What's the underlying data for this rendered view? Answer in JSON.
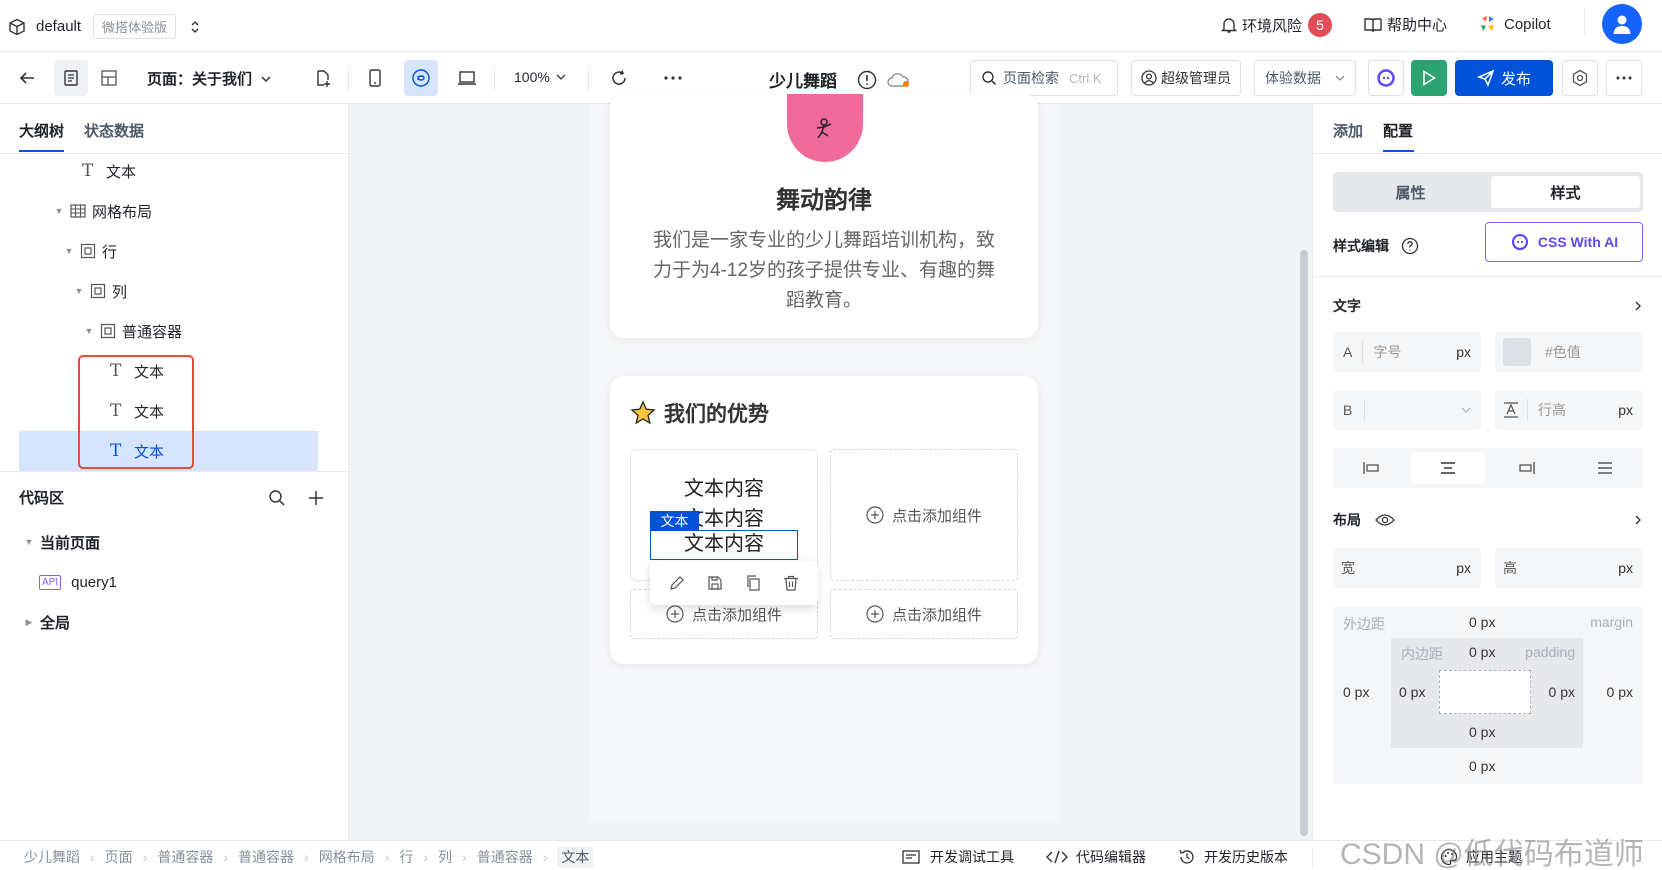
{
  "topbar": {
    "workspace": "default",
    "edition_badge": "微搭体验版",
    "env_risk_label": "环境风险",
    "env_risk_count": "5",
    "help_label": "帮助中心",
    "copilot_label": "Copilot"
  },
  "toolbar": {
    "page_label": "页面：关于我们",
    "zoom": "100%",
    "app_title": "少儿舞蹈",
    "search_placeholder": "页面检索",
    "search_shortcut": "Ctrl K",
    "admin_label": "超级管理员",
    "data_select": "体验数据",
    "publish_label": "发布"
  },
  "left_panel": {
    "tabs": [
      "大纲树",
      "状态数据"
    ],
    "tree": [
      {
        "label": "文本",
        "icon": "T",
        "caret": false
      },
      {
        "label": "网格布局",
        "icon": "grid",
        "caret": true
      },
      {
        "label": "行",
        "icon": "box",
        "caret": true
      },
      {
        "label": "列",
        "icon": "box",
        "caret": true
      },
      {
        "label": "普通容器",
        "icon": "box",
        "caret": true
      },
      {
        "label": "文本",
        "icon": "T",
        "caret": false
      },
      {
        "label": "文本",
        "icon": "T",
        "caret": false
      },
      {
        "label": "文本",
        "icon": "T",
        "caret": false
      }
    ],
    "code_area": {
      "title": "代码区",
      "current_page": "当前页面",
      "query": "query1",
      "api_badge": "API",
      "global": "全局"
    }
  },
  "canvas": {
    "hero": {
      "title": "舞动韵律",
      "desc_line1": "我们是一家专业的少儿舞蹈培训机构，致",
      "desc_line2": "力于为4-12岁的孩子提供专业、有趣的舞",
      "desc_line3": "蹈教育。"
    },
    "advantages": {
      "title": "我们的优势",
      "text1": "文本内容",
      "text2": "文本内容",
      "text3": "文本内容",
      "selected_tag": "文本",
      "add_component": "点击添加组件"
    }
  },
  "right_panel": {
    "tabs": [
      "添加",
      "配置"
    ],
    "segments": [
      "属性",
      "样式"
    ],
    "style_edit_label": "样式编辑",
    "css_ai_label": "CSS With AI",
    "text_section": "文字",
    "font_size_prefix": "A",
    "font_size_placeholder": "字号",
    "unit_px": "px",
    "color_placeholder": "#色值",
    "bold_prefix": "B",
    "line_height_placeholder": "行高",
    "layout_section": "布局",
    "width_label": "宽",
    "height_label": "高",
    "margin_label": "外边距",
    "margin_en": "margin",
    "padding_label": "内边距",
    "padding_en": "padding",
    "zero_px": "0 px"
  },
  "statusbar": {
    "breadcrumb": [
      "少儿舞蹈",
      "页面",
      "普通容器",
      "普通容器",
      "网格布局",
      "行",
      "列",
      "普通容器",
      "文本"
    ],
    "debug_tool": "开发调试工具",
    "code_editor": "代码编辑器",
    "history": "开发历史版本",
    "theme": "应用主题",
    "watermark": "CSDN @低代码布道师"
  },
  "colors": {
    "primary": "#0052d9",
    "selected_bg": "#d6e4ff",
    "highlight_red": "#e34d3a",
    "badge_red": "#e34d59",
    "run_green": "#2ba471"
  }
}
